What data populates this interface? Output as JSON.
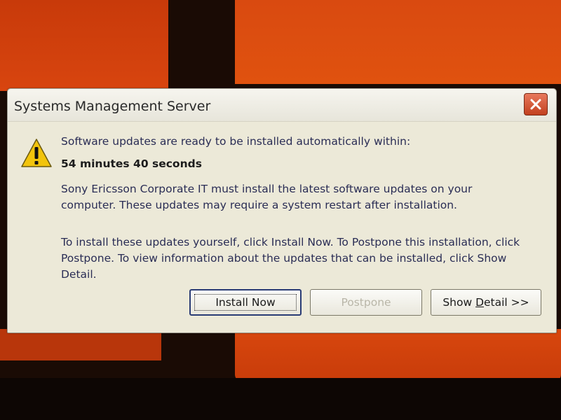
{
  "window": {
    "title": "Systems Management Server",
    "close_icon": "close-icon"
  },
  "message": {
    "icon": "warning-icon",
    "line1": "Software updates are ready to be installed automatically within:",
    "countdown": "54 minutes 40 seconds",
    "paragraph1": "Sony Ericsson Corporate IT must install the latest software updates on your computer. These updates may require a system restart after installation.",
    "paragraph2": "To install these updates yourself, click Install Now. To Postpone this installation, click Postpone. To view information about the updates that can be installed, click Show Detail."
  },
  "buttons": {
    "install_now": "Install Now",
    "postpone": "Postpone",
    "show_detail_prefix": "Show ",
    "show_detail_underlined": "D",
    "show_detail_suffix": "etail >>"
  },
  "colors": {
    "desktop_orange": "#d8400c",
    "dialog_bg": "#ece9d8",
    "close_red": "#c2401f",
    "warning_yellow": "#f2c40c"
  }
}
